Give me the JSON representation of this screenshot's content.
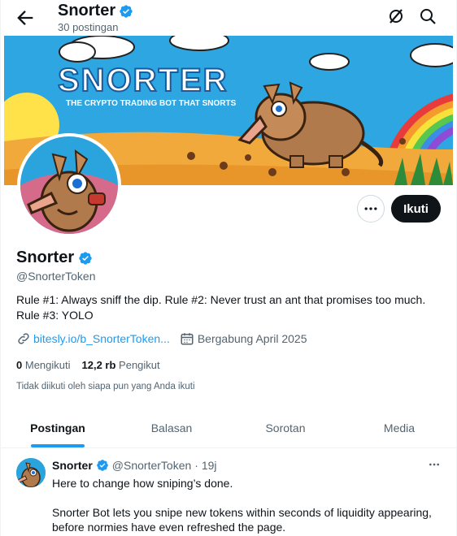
{
  "header": {
    "title": "Snorter",
    "post_count": "30 postingan"
  },
  "banner": {
    "headline": "SNORTER",
    "tagline": "THE CRYPTO TRADING BOT THAT SNORTS"
  },
  "profile": {
    "name": "Snorter",
    "handle": "@SnorterToken",
    "bio": "Rule #1: Always sniff the dip. Rule #2: Never trust an ant that promises too much. Rule #3: YOLO",
    "link": "bitesly.io/b_SnorterToken...",
    "joined": "Bergabung April 2025",
    "following_count": "0",
    "following_label": "Mengikuti",
    "followers_count": "12,2 rb",
    "followers_label": "Pengikut",
    "follow_note": "Tidak diikuti oleh siapa pun yang Anda ikuti",
    "follow_button": "Ikuti"
  },
  "tabs": [
    "Postingan",
    "Balasan",
    "Sorotan",
    "Media"
  ],
  "post": {
    "name": "Snorter",
    "handle": "@SnorterToken",
    "time": "· 19j",
    "line1": "Here to change how sniping’s done.",
    "line2": "Snorter Bot lets you snipe new tokens within seconds of liquidity appearing, before normies have even refreshed the page."
  },
  "colors": {
    "accent": "#1d9bf0",
    "verified": "#1d9bf0",
    "text": "#0f1419",
    "muted": "#536471",
    "button_dark": "#0f1419",
    "banner_sky": "#29a3e0",
    "banner_sand": "#f2a93b"
  },
  "icons": [
    "back-arrow-icon",
    "verified-badge-icon",
    "grok-icon",
    "search-icon",
    "more-icon",
    "link-icon",
    "calendar-icon"
  ]
}
